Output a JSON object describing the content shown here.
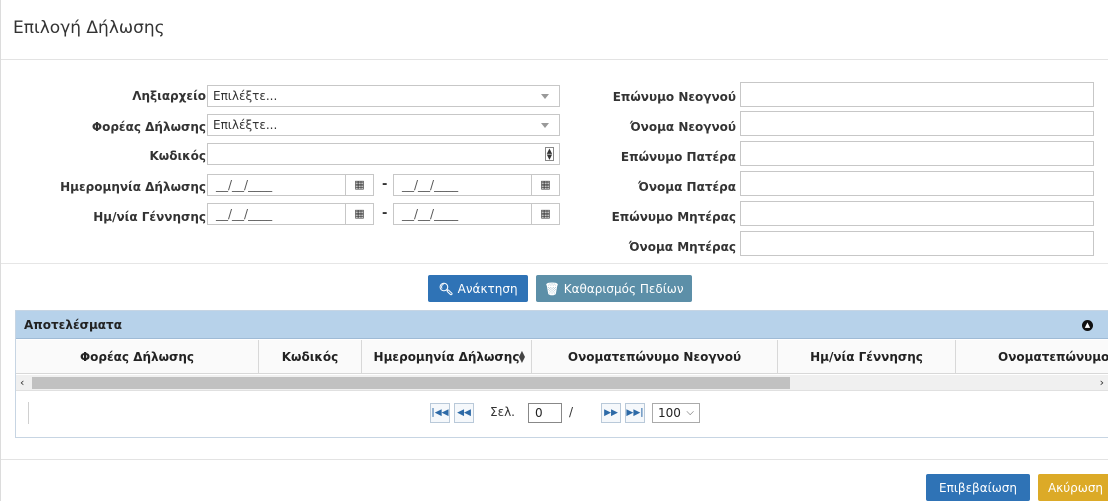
{
  "dialog": {
    "title": "Επιλογή Δήλωσης"
  },
  "form": {
    "left": {
      "registry": {
        "label": "Ληξιαρχείο",
        "value": "Επιλέξτε..."
      },
      "declarant": {
        "label": "Φορέας Δήλωσης",
        "value": "Επιλέξτε..."
      },
      "code": {
        "label": "Κωδικός",
        "value": ""
      },
      "declaration_date": {
        "label": "Ημερομηνία Δήλωσης",
        "from": "__/__/____",
        "to": "__/__/____",
        "separator": "-"
      },
      "birth_date": {
        "label": "Ημ/νία Γέννησης",
        "from": "__/__/____",
        "to": "__/__/____",
        "separator": "-"
      }
    },
    "right": {
      "newborn_surname": {
        "label": "Επώνυμο Νεογνού",
        "value": ""
      },
      "newborn_name": {
        "label": "Όνομα Νεογνού",
        "value": ""
      },
      "father_surname": {
        "label": "Επώνυμο Πατέρα",
        "value": ""
      },
      "father_name": {
        "label": "Όνομα Πατέρα",
        "value": ""
      },
      "mother_surname": {
        "label": "Επώνυμο Μητέρας",
        "value": ""
      },
      "mother_name": {
        "label": "Όνομα Μητέρας",
        "value": ""
      }
    }
  },
  "actions": {
    "search_label": "Ανάκτηση",
    "clear_label": "Καθαρισμός Πεδίων"
  },
  "results": {
    "title": "Αποτελέσματα",
    "columns": [
      "Φορέας Δήλωσης",
      "Κωδικός",
      "Ημερομηνία Δήλωσης",
      "Ονοματεπώνυμο Νεογνού",
      "Ημ/νία Γέννησης",
      "Ονοματεπώνυμο"
    ],
    "rows": []
  },
  "pager": {
    "page_label": "Σελ.",
    "page_value": "0",
    "of_separator": "/",
    "page_size": "100"
  },
  "footer": {
    "confirm_label": "Επιβεβαίωση",
    "cancel_label": "Ακύρωση"
  },
  "icons": {
    "dropdown": "caret-down-icon",
    "calendar": "calendar-icon",
    "spinner": "spinner-icon",
    "search": "search-icon",
    "trash": "trash-icon",
    "collapse": "collapse-icon",
    "sort": "sort-icon"
  },
  "colors": {
    "primary": "#2f73b6",
    "secondary": "#5c8fa8",
    "warning": "#dcaa27",
    "panel_header": "#b7d2ea"
  }
}
